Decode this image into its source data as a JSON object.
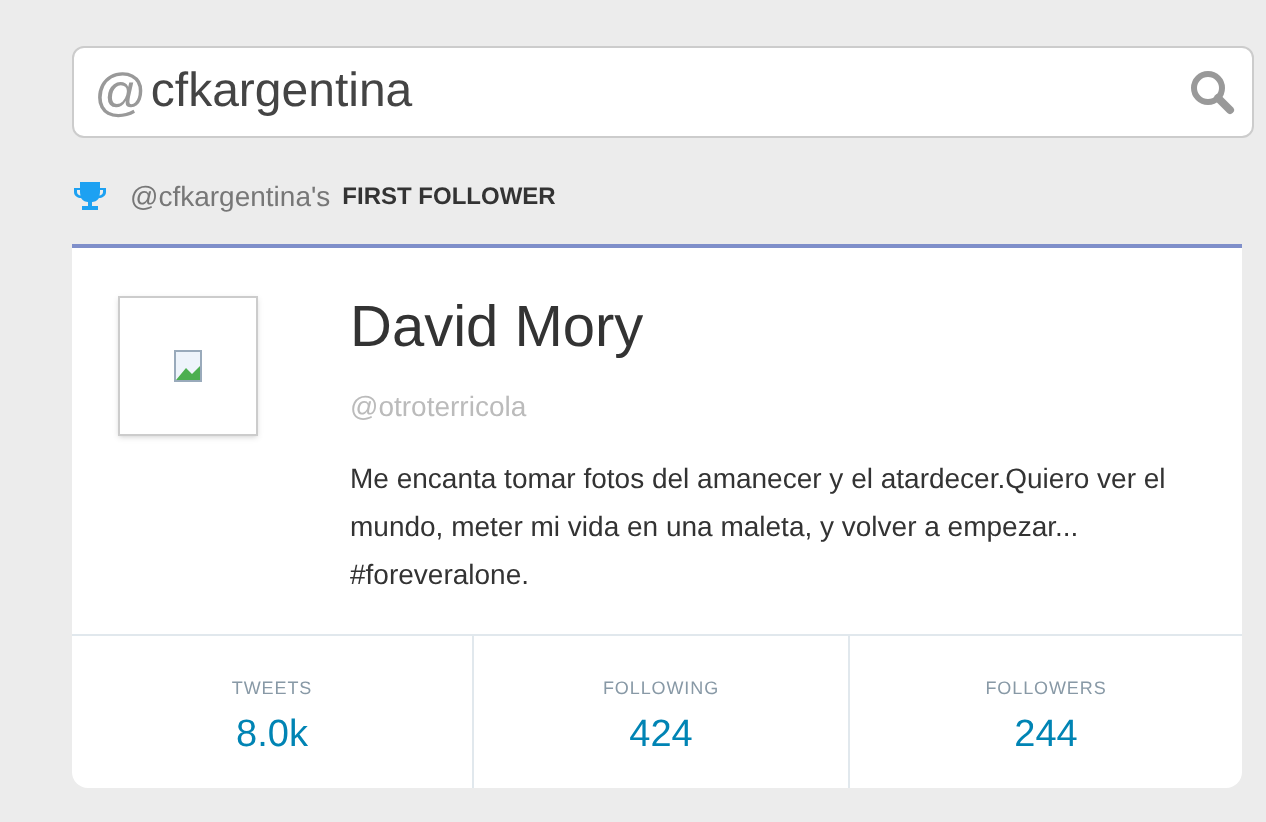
{
  "search": {
    "prefix": "@",
    "value": "cfkargentina"
  },
  "heading": {
    "handle": "@cfkargentina's",
    "title": "FIRST FOLLOWER"
  },
  "profile": {
    "name": "David Mory",
    "handle": "@otroterricola",
    "bio": "Me encanta tomar fotos del amanecer y el atardecer.Quiero ver el mundo, meter mi vida en una maleta, y volver a empezar... #foreveralone."
  },
  "stats": [
    {
      "label": "TWEETS",
      "value": "8.0k"
    },
    {
      "label": "FOLLOWING",
      "value": "424"
    },
    {
      "label": "FOLLOWERS",
      "value": "244"
    }
  ]
}
